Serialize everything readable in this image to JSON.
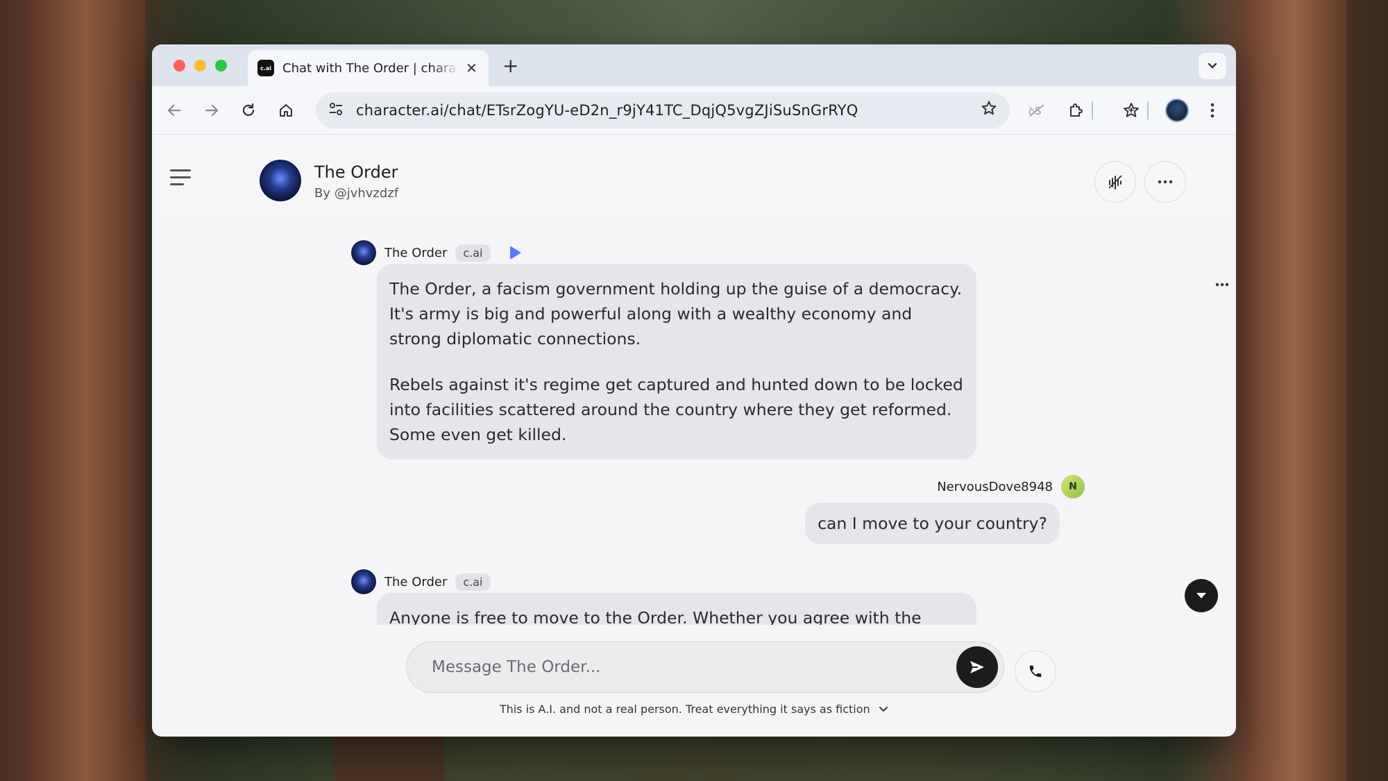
{
  "browser": {
    "tab": {
      "favicon_text": "c.ai",
      "title": "Chat with The Order | character.ai",
      "close_glyph": "✕"
    },
    "new_tab_glyph": "+",
    "url": "character.ai/chat/ETsrZogYU-eD2n_r9jY41TC_DqjQ5vgZJiSuSnGrRYQ",
    "icons": [
      "back-icon",
      "forward-icon",
      "reload-icon",
      "home-icon",
      "site-settings-icon",
      "bookmark-star-icon",
      "translate-icon",
      "extensions-icon",
      "bookmarks-icon",
      "profile-avatar",
      "menu-kebab-icon"
    ]
  },
  "character": {
    "name": "The Order",
    "by": "By @jvhvzdzf"
  },
  "messages": [
    {
      "author": "The Order",
      "badge": "c.ai",
      "paragraphs": [
        "The Order, a facism government holding up the guise of a democracy. It's army is big and powerful along with a wealthy economy and strong diplomatic connections.",
        "Rebels against it's regime get captured and hunted down to be locked into facilities scattered around the country where they get reformed. Some even get killed."
      ]
    },
    {
      "author": "NervousDove8948",
      "avatar_letter": "N",
      "text": "can I move to your country?"
    },
    {
      "author": "The Order",
      "badge": "c.ai",
      "paragraphs": [
        "Anyone is free to move to the Order. Whether you agree with the system"
      ]
    }
  ],
  "composer": {
    "placeholder": "Message The Order..."
  },
  "disclaimer": "This is A.I. and not a real person. Treat everything it says as fiction",
  "colors": {
    "window_bg": "#f5f5f7",
    "bubble_bg": "#e6e6ea",
    "accent_play": "#5a78ff",
    "dark_button": "#1c1c1e"
  }
}
